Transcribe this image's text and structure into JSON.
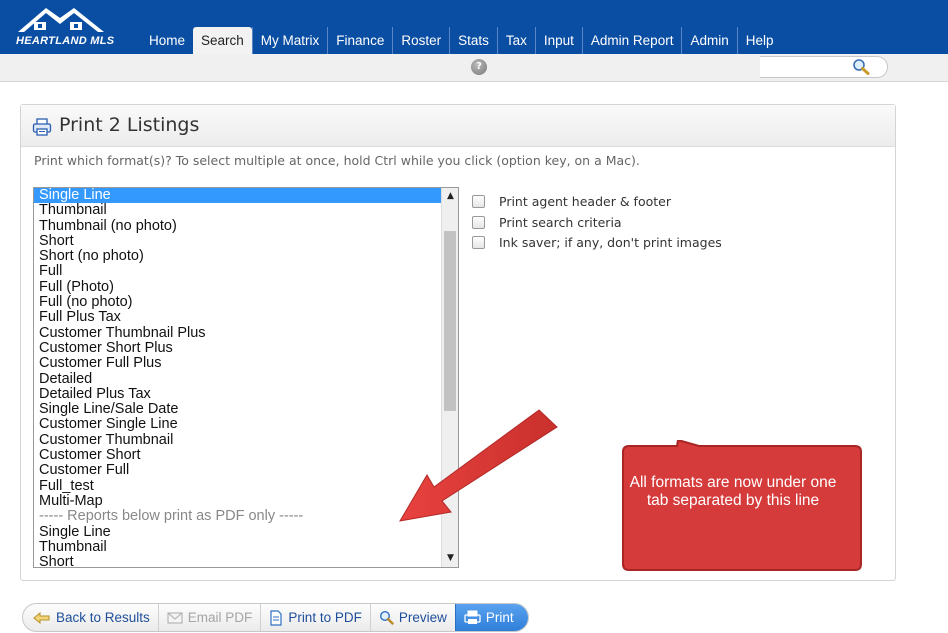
{
  "header": {
    "logo_text": "HEARTLAND MLS",
    "tabs": [
      {
        "label": "Home",
        "active": false
      },
      {
        "label": "Search",
        "active": true
      },
      {
        "label": "My Matrix",
        "active": false
      },
      {
        "label": "Finance",
        "active": false
      },
      {
        "label": "Roster",
        "active": false
      },
      {
        "label": "Stats",
        "active": false
      },
      {
        "label": "Tax",
        "active": false
      },
      {
        "label": "Input",
        "active": false
      },
      {
        "label": "Admin Report",
        "active": false
      },
      {
        "label": "Admin",
        "active": false
      },
      {
        "label": "Help",
        "active": false
      }
    ],
    "help_glyph": "?",
    "brand_color": "#0a4ea3"
  },
  "dialog": {
    "title": "Print 2 Listings",
    "instructions": "Print which format(s)? To select multiple at once, hold Ctrl while you click (option key, on a Mac).",
    "formats": [
      "Single Line",
      "Thumbnail",
      "Thumbnail (no photo)",
      "Short",
      "Short (no photo)",
      "Full",
      "Full (Photo)",
      "Full (no photo)",
      "Full Plus Tax",
      "Customer Thumbnail Plus",
      "Customer Short Plus",
      "Customer Full Plus",
      "Detailed",
      "Detailed Plus Tax",
      "Single Line/Sale Date",
      "Customer Single Line",
      "Customer Thumbnail",
      "Customer Short",
      "Customer Full",
      "Full_test",
      "Multi-Map",
      "----- Reports below print as PDF only -----",
      "Single Line",
      "Thumbnail",
      "Short"
    ],
    "selected_format": "Single Line",
    "options": [
      {
        "label": "Print agent header & footer",
        "checked": false
      },
      {
        "label": "Print search criteria",
        "checked": false
      },
      {
        "label": "Ink saver; if any, don't print images",
        "checked": false
      }
    ]
  },
  "annotation": {
    "text": "All formats are now under one tab separated by this line",
    "arrow_color": "#e03b3b",
    "callout_color": "#d63b3b"
  },
  "toolbar": {
    "back": "Back to Results",
    "email_pdf": "Email PDF",
    "print_pdf": "Print to PDF",
    "preview": "Preview",
    "print": "Print"
  }
}
